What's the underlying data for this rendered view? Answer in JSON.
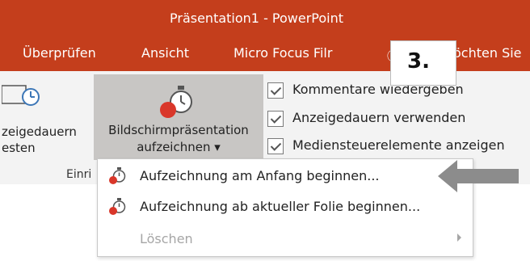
{
  "window": {
    "title": "Präsentation1 - PowerPoint"
  },
  "tabs": [
    {
      "label": "Überprüfen"
    },
    {
      "label": "Ansicht"
    },
    {
      "label": "Micro Focus Filr"
    },
    {
      "label": "ⓘ"
    },
    {
      "label": "öchten Sie"
    }
  ],
  "callout": {
    "text": "3."
  },
  "ribbon": {
    "left_button": {
      "line1": "zeigedauern",
      "line2": "esten"
    },
    "record_button": {
      "line1": "Bildschirmpräsentation",
      "line2": "aufzeichnen ▾"
    },
    "group_label": "Einri",
    "checkboxes": [
      {
        "label": "Kommentare wiedergeben"
      },
      {
        "label": "Anzeigedauern verwenden"
      },
      {
        "label": "Mediensteuerelemente anzeigen"
      }
    ]
  },
  "menu": {
    "items": [
      {
        "label": "Aufzeichnung am Anfang beginnen...",
        "enabled": true
      },
      {
        "label": "Aufzeichnung ab aktueller Folie beginnen...",
        "enabled": true
      },
      {
        "label": "Löschen",
        "enabled": false
      }
    ]
  },
  "colors": {
    "accent": "#c43e1c",
    "ribbon_bg": "#f3f3f3",
    "pressed": "#c8c6c4"
  }
}
